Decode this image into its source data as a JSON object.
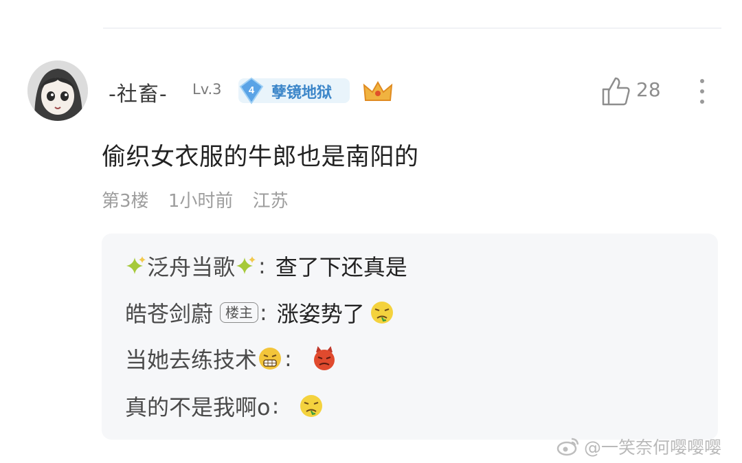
{
  "comment": {
    "username": "-社畜-",
    "level": "Lv.3",
    "badge": {
      "number": "4",
      "label": "孽镜地狱"
    },
    "likes": "28",
    "text": "偷织女衣服的牛郎也是南阳的",
    "meta": {
      "floor": "第3楼",
      "time": "1小时前",
      "location": "江苏"
    }
  },
  "replies": [
    {
      "user": "泛舟当歌",
      "user_icons": [
        "sparkle-icon",
        "sparkle-icon"
      ],
      "host": false,
      "colon": ":",
      "message": "查了下还真是",
      "emoji": null
    },
    {
      "user": "皓苍剑蔚",
      "host": true,
      "host_label": "楼主",
      "colon": ":",
      "message": "涨姿势了",
      "emoji": "disgust-emoji-icon"
    },
    {
      "user": "当她去练技术",
      "user_icons": [
        "grimace-emoji-icon"
      ],
      "host": false,
      "colon": ":",
      "message": "",
      "emoji": "angry-devil-emoji-icon"
    },
    {
      "user": "真的不是我啊o",
      "host": false,
      "colon": ":",
      "message": "",
      "emoji": "disgust-emoji-icon"
    }
  ],
  "watermark": {
    "text": "@一笑奈何嘤嘤嘤",
    "icon": "weibo-icon"
  },
  "colors": {
    "badge_text": "#3c86c9",
    "meta_gray": "#9d9d9d",
    "reply_bg": "#f6f7f9"
  }
}
